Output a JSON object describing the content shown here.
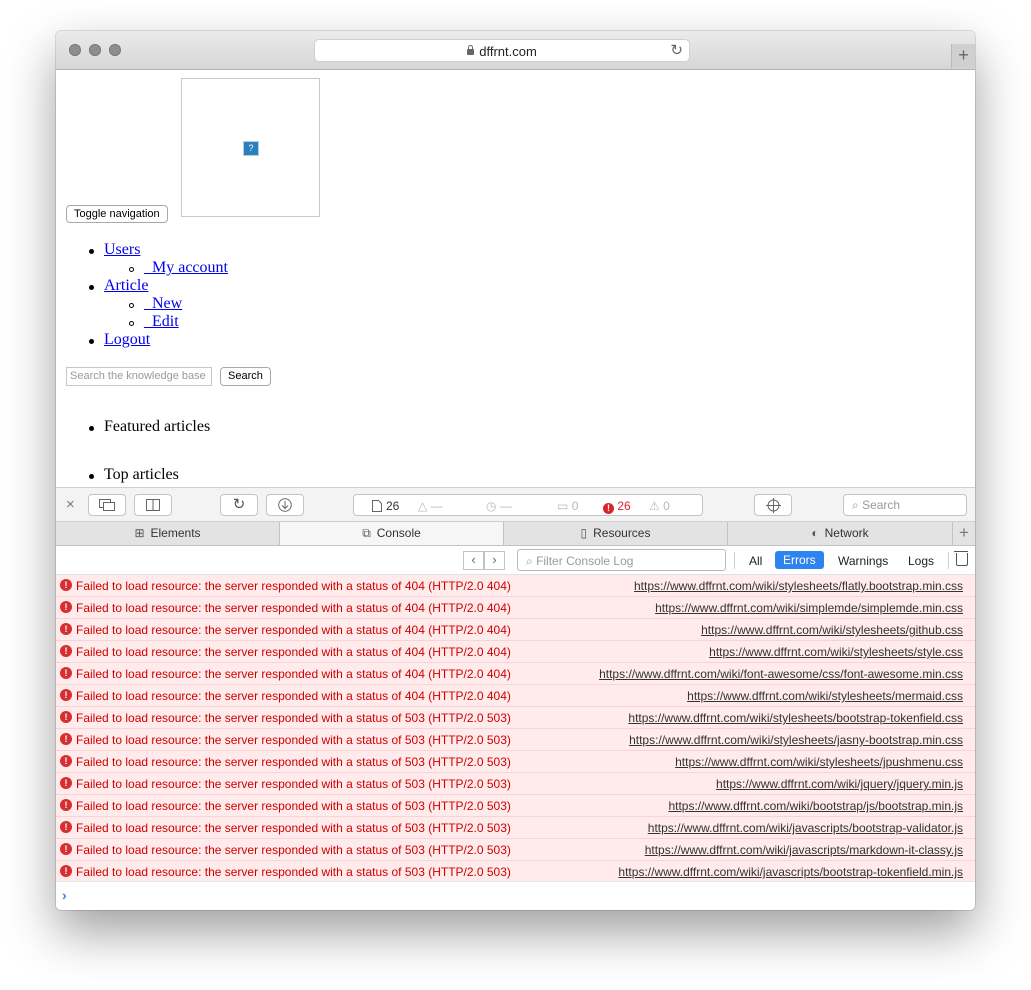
{
  "browser": {
    "host": "dffrnt.com",
    "new_tab_label": "+"
  },
  "page": {
    "toggle_nav_label": "Toggle navigation",
    "image_placeholder": "?",
    "nav": {
      "users": "Users",
      "my_account": "_My account",
      "article": "Article",
      "new": "_New",
      "edit": "_Edit",
      "logout": "Logout"
    },
    "search_placeholder": "Search the knowledge base",
    "search_button": "Search",
    "featured": "Featured articles",
    "top": "Top articles"
  },
  "devtools": {
    "resources_count": "26",
    "dash1": "—",
    "dash2": "—",
    "messages_count": "0",
    "errors_count": "26",
    "warnings_count": "0",
    "search_placeholder": "Search",
    "tabs": {
      "elements": "Elements",
      "console": "Console",
      "resources": "Resources",
      "network": "Network"
    },
    "filter_placeholder": "Filter Console Log",
    "filters": {
      "all": "All",
      "errors": "Errors",
      "warnings": "Warnings",
      "logs": "Logs"
    },
    "prompt": "›"
  },
  "log": [
    {
      "message": "Failed to load resource: the server responded with a status of 404 (HTTP/2.0 404)",
      "url": "https://www.dffrnt.com/wiki/stylesheets/flatly.bootstrap.min.css"
    },
    {
      "message": "Failed to load resource: the server responded with a status of 404 (HTTP/2.0 404)",
      "url": "https://www.dffrnt.com/wiki/simplemde/simplemde.min.css"
    },
    {
      "message": "Failed to load resource: the server responded with a status of 404 (HTTP/2.0 404)",
      "url": "https://www.dffrnt.com/wiki/stylesheets/github.css"
    },
    {
      "message": "Failed to load resource: the server responded with a status of 404 (HTTP/2.0 404)",
      "url": "https://www.dffrnt.com/wiki/stylesheets/style.css"
    },
    {
      "message": "Failed to load resource: the server responded with a status of 404 (HTTP/2.0 404)",
      "url": "https://www.dffrnt.com/wiki/font-awesome/css/font-awesome.min.css"
    },
    {
      "message": "Failed to load resource: the server responded with a status of 404 (HTTP/2.0 404)",
      "url": "https://www.dffrnt.com/wiki/stylesheets/mermaid.css"
    },
    {
      "message": "Failed to load resource: the server responded with a status of 503 (HTTP/2.0 503)",
      "url": "https://www.dffrnt.com/wiki/stylesheets/bootstrap-tokenfield.css"
    },
    {
      "message": "Failed to load resource: the server responded with a status of 503 (HTTP/2.0 503)",
      "url": "https://www.dffrnt.com/wiki/stylesheets/jasny-bootstrap.min.css"
    },
    {
      "message": "Failed to load resource: the server responded with a status of 503 (HTTP/2.0 503)",
      "url": "https://www.dffrnt.com/wiki/stylesheets/jpushmenu.css"
    },
    {
      "message": "Failed to load resource: the server responded with a status of 503 (HTTP/2.0 503)",
      "url": "https://www.dffrnt.com/wiki/jquery/jquery.min.js"
    },
    {
      "message": "Failed to load resource: the server responded with a status of 503 (HTTP/2.0 503)",
      "url": "https://www.dffrnt.com/wiki/bootstrap/js/bootstrap.min.js"
    },
    {
      "message": "Failed to load resource: the server responded with a status of 503 (HTTP/2.0 503)",
      "url": "https://www.dffrnt.com/wiki/javascripts/bootstrap-validator.js"
    },
    {
      "message": "Failed to load resource: the server responded with a status of 503 (HTTP/2.0 503)",
      "url": "https://www.dffrnt.com/wiki/javascripts/markdown-it-classy.js"
    },
    {
      "message": "Failed to load resource: the server responded with a status of 503 (HTTP/2.0 503)",
      "url": "https://www.dffrnt.com/wiki/javascripts/bootstrap-tokenfield.min.js"
    }
  ]
}
